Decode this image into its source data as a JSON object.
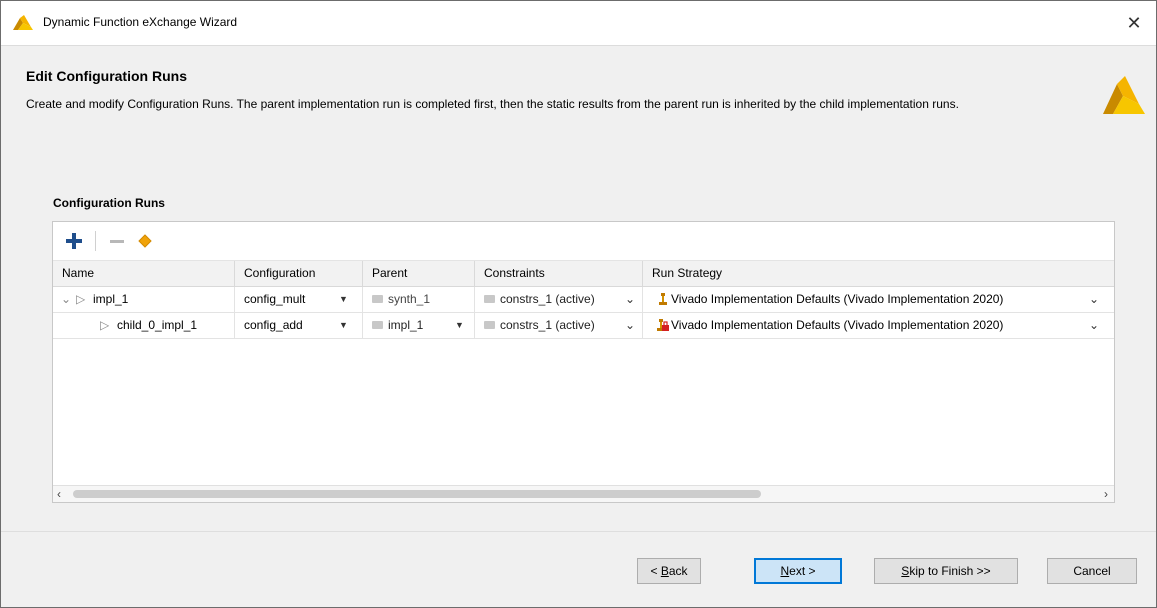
{
  "window": {
    "title": "Dynamic Function eXchange Wizard",
    "close_glyph": "✕"
  },
  "header": {
    "title": "Edit Configuration Runs",
    "description": "Create and modify Configuration Runs. The parent implementation run is completed first, then the static results from the parent run is inherited by the child implementation runs."
  },
  "section_label": "Configuration Runs",
  "toolbar": {
    "add_icon": "plus-icon",
    "remove_icon": "minus-icon",
    "auto_icon": "diamond-icon"
  },
  "table": {
    "columns": [
      "Name",
      "Configuration",
      "Parent",
      "Constraints",
      "Run Strategy"
    ],
    "rows": [
      {
        "name": "impl_1",
        "configuration": "config_mult",
        "parent": "synth_1",
        "constraints": "constrs_1 (active)",
        "strategy": "Vivado Implementation Defaults (Vivado Implementation 2020)"
      },
      {
        "name": "child_0_impl_1",
        "configuration": "config_add",
        "parent": "impl_1",
        "constraints": "constrs_1 (active)",
        "strategy": "Vivado Implementation Defaults (Vivado Implementation 2020)"
      }
    ]
  },
  "buttons": {
    "back_prefix": "< ",
    "back_mnemonic": "B",
    "back_rest": "ack",
    "next_mnemonic": "N",
    "next_rest": "ext >",
    "skip_mnemonic": "S",
    "skip_rest": "kip to Finish >>",
    "cancel": "Cancel"
  },
  "colors": {
    "accent": "#0078d7",
    "brand": "#f5b400",
    "add_icon": "#1f4e8c",
    "diamond_icon": "#f0a30a"
  }
}
